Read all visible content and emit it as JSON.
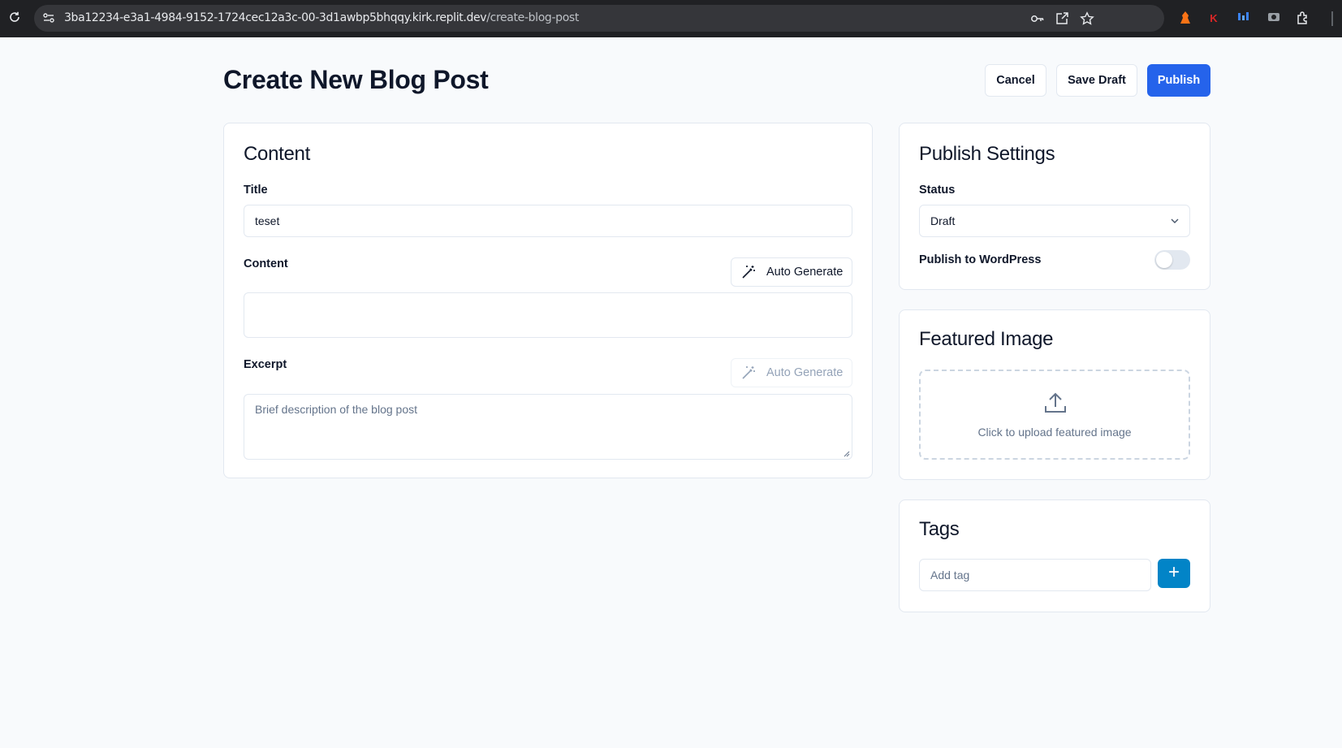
{
  "browser": {
    "url_host": "3ba12234-e3a1-4984-9152-1724cec12a3c-00-3d1awbp5bhqqy.kirk.replit.dev",
    "url_path": "/create-blog-post",
    "extensions": [
      {
        "name": "extension-fox-icon",
        "glyph": "♟",
        "color": "#f97316"
      },
      {
        "name": "extension-k-icon",
        "glyph": "K",
        "color": "#dc2626"
      },
      {
        "name": "extension-bars-icon",
        "glyph": "≡",
        "color": "#3b82f6"
      }
    ]
  },
  "header": {
    "title": "Create New Blog Post",
    "cancel_label": "Cancel",
    "save_draft_label": "Save Draft",
    "publish_label": "Publish"
  },
  "content_card": {
    "heading": "Content",
    "title_label": "Title",
    "title_value": "teset",
    "content_label": "Content",
    "content_value": "",
    "auto_generate_label": "Auto Generate",
    "excerpt_label": "Excerpt",
    "excerpt_placeholder": "Brief description of the blog post",
    "excerpt_auto_generate_label": "Auto Generate"
  },
  "publish_settings": {
    "heading": "Publish Settings",
    "status_label": "Status",
    "status_value": "Draft",
    "wordpress_label": "Publish to WordPress",
    "wordpress_enabled": false
  },
  "featured_image": {
    "heading": "Featured Image",
    "upload_text": "Click to upload featured image"
  },
  "tags": {
    "heading": "Tags",
    "placeholder": "Add tag",
    "add_label": "+"
  },
  "colors": {
    "primary": "#2563eb",
    "tag_button": "#0284c7",
    "browser_bar": "#202124"
  }
}
